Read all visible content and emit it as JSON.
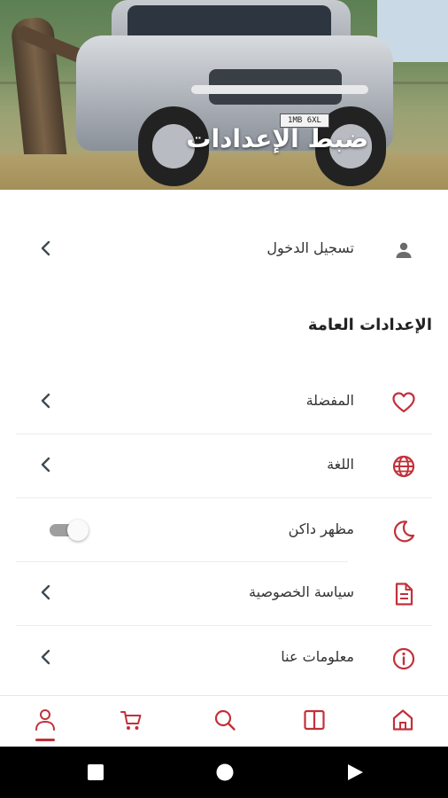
{
  "colors": {
    "accent": "#c2303a",
    "icon_gray": "#6b6b6b",
    "chevron": "#3f4a52"
  },
  "header": {
    "title": "ضبط الإعدادات",
    "image_plate_text": "1MB 6XL"
  },
  "account": {
    "login_label": "تسجيل الدخول",
    "icon": "person-icon"
  },
  "general_settings": {
    "title": "الإعدادات العامة",
    "items": [
      {
        "label": "المفضلة",
        "icon": "heart-icon",
        "control": "chevron"
      },
      {
        "label": "اللغة",
        "icon": "globe-icon",
        "control": "chevron"
      },
      {
        "label": "مظهر داكن",
        "icon": "moon-icon",
        "control": "toggle",
        "enabled": false
      },
      {
        "label": "سياسة الخصوصية",
        "icon": "document-icon",
        "control": "chevron"
      },
      {
        "label": "معلومات عنا",
        "icon": "info-icon",
        "control": "chevron"
      }
    ]
  },
  "bottom_nav": {
    "items": [
      {
        "icon": "profile-icon",
        "active": true
      },
      {
        "icon": "cart-icon",
        "active": false
      },
      {
        "icon": "search-icon",
        "active": false
      },
      {
        "icon": "catalog-icon",
        "active": false
      },
      {
        "icon": "home-icon",
        "active": false
      }
    ]
  },
  "system_nav": {
    "buttons": [
      "recents-square-icon",
      "home-circle-icon",
      "back-triangle-icon"
    ]
  }
}
